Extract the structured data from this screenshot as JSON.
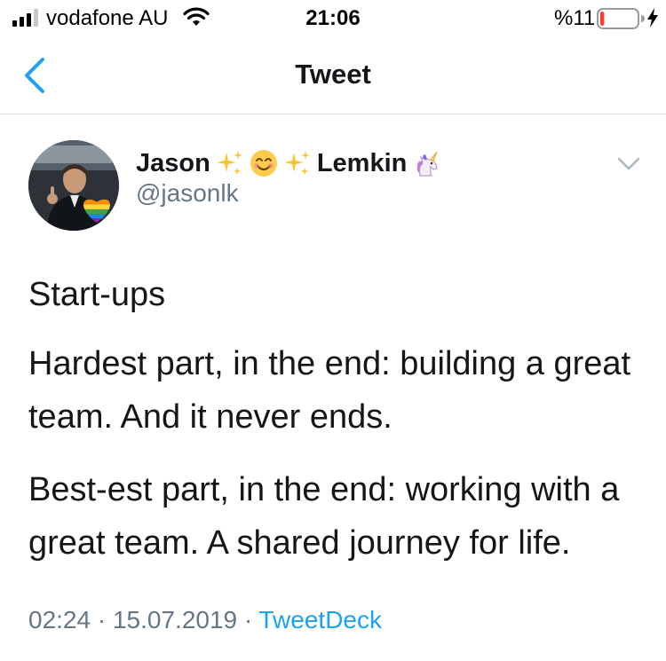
{
  "status_bar": {
    "carrier": "vodafone AU",
    "time": "21:06",
    "battery_percent": "%11",
    "battery_level": 0.11
  },
  "nav": {
    "title": "Tweet"
  },
  "tweet": {
    "author": {
      "name_first": "Jason",
      "name_last": "Lemkin",
      "handle": "@jasonlk"
    },
    "paragraphs": [
      "Start-ups",
      "Hardest part, in the end: building a great team.  And it never ends.",
      "Best-est part, in the end: working with a great team.  A shared journey for life."
    ],
    "time": "02:24",
    "separator": "·",
    "date": "15.07.2019",
    "source": "TweetDeck"
  },
  "colors": {
    "link": "#1da1f2",
    "secondary_text": "#657786",
    "battery_low": "#ff3b30"
  }
}
